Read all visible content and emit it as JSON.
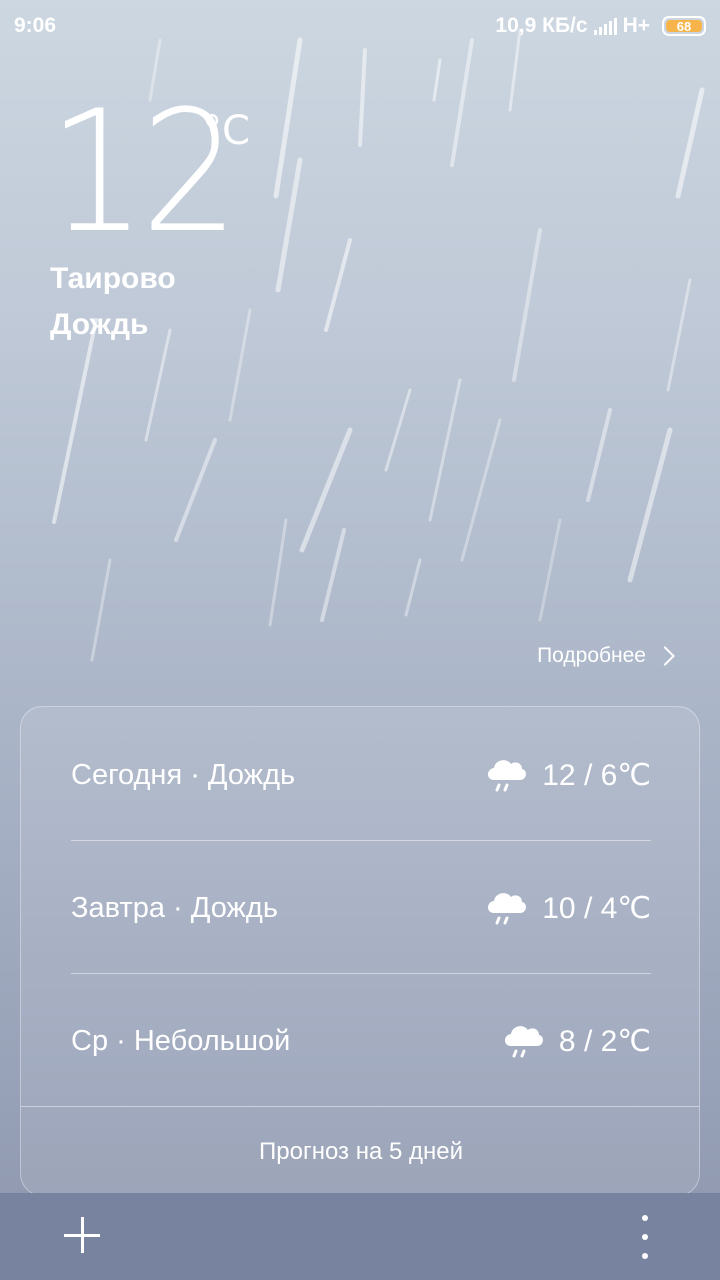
{
  "status_bar": {
    "time": "9:06",
    "network_speed": "10,9 КБ/с",
    "network_type": "H+",
    "battery_level": "68",
    "battery_color": "#f6b44a",
    "signal_icon": "signal-bars-icon"
  },
  "current": {
    "temperature": "12",
    "unit": "°C",
    "city": "Таирово",
    "condition": "Дождь",
    "background": "rain"
  },
  "details_link": {
    "label": "Подробнее",
    "icon": "chevron-right-icon"
  },
  "forecast": {
    "rows": [
      {
        "label": "Сегодня · Дождь",
        "icon": "cloud-rain-icon",
        "temps": "12 / 6℃"
      },
      {
        "label": "Завтра · Дождь",
        "icon": "cloud-rain-icon",
        "temps": "10 / 4℃"
      },
      {
        "label": "Ср · Небольшой",
        "icon": "cloud-rain-icon",
        "temps": "8 / 2℃"
      }
    ],
    "five_day_label": "Прогноз на 5 дней"
  },
  "bottom_bar": {
    "add_icon": "plus-icon",
    "menu_icon": "more-vertical-icon"
  }
}
